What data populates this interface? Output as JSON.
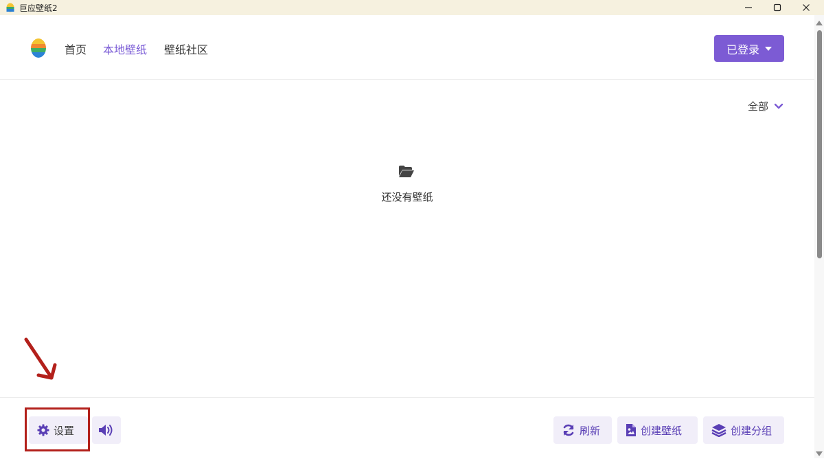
{
  "window": {
    "title": "巨应壁纸2",
    "icons": {
      "minimize": "minimize-icon",
      "maximize": "maximize-icon",
      "close": "close-icon"
    }
  },
  "header": {
    "nav": [
      {
        "label": "首页",
        "active": false
      },
      {
        "label": "本地壁纸",
        "active": true
      },
      {
        "label": "壁纸社区",
        "active": false
      }
    ],
    "login_label": "已登录"
  },
  "filter": {
    "selected": "全部"
  },
  "empty_state": {
    "text": "还没有壁纸",
    "icon": "folder-open-icon"
  },
  "footer": {
    "settings_label": "设置",
    "refresh_label": "刷新",
    "create_wallpaper_label": "创建壁纸",
    "create_group_label": "创建分组"
  },
  "colors": {
    "accent": "#7c5bd4",
    "active_nav": "#7a5bd6",
    "titlebar": "#f6f1df",
    "button_bg": "#f1eef9",
    "annotation": "#b3201b"
  }
}
